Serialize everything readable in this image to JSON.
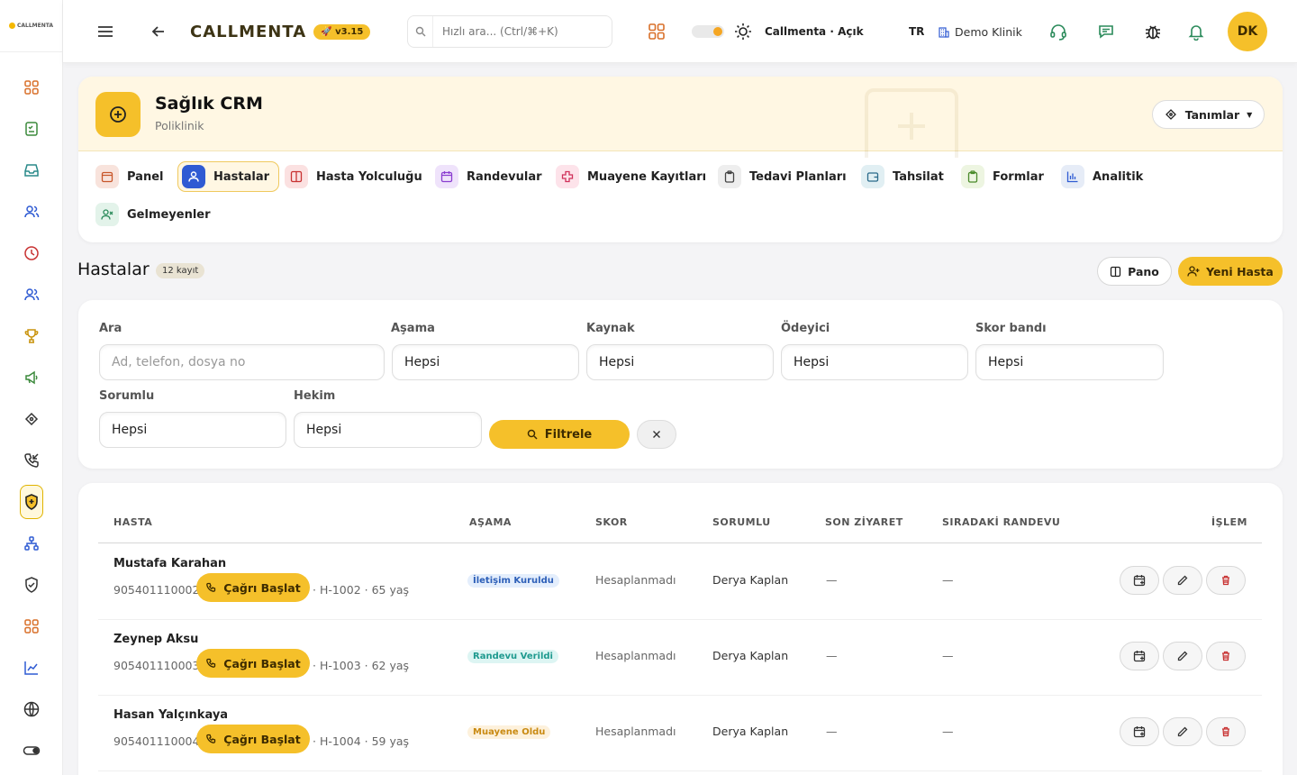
{
  "sidebar": {
    "logo_text": "CALLMENTA",
    "icons": [
      "grid-icon",
      "checklist-icon",
      "inbox-icon",
      "users-icon",
      "clock-icon",
      "team-icon",
      "trophy-icon",
      "megaphone-icon",
      "tags-icon",
      "incoming-call-icon",
      "shield-plus-icon",
      "sitemap-icon",
      "shield-check-icon",
      "apps-icon",
      "chart-line-icon",
      "globe-icon",
      "toggle-icon"
    ],
    "active_index": 10
  },
  "header": {
    "brand": "CALLMENTA",
    "version": "v3.15",
    "search_placeholder": "Hızlı ara... (Ctrl/⌘+K)",
    "company_status": "Callmenta · Açık",
    "language": "TR",
    "clinic": "Demo Klinik",
    "avatar_initials": "DK"
  },
  "module": {
    "title": "Sağlık CRM",
    "subtitle": "Poliklinik",
    "definitions_label": "Tanımlar",
    "tabs": [
      {
        "label": "Panel",
        "icon": "calendar-panel-icon",
        "color": "#f8e3dc"
      },
      {
        "label": "Hastalar",
        "icon": "user-icon",
        "color": "#2f5bd3"
      },
      {
        "label": "Hasta Yolculuğu",
        "icon": "columns-icon",
        "color": "#fbe1e1"
      },
      {
        "label": "Randevular",
        "icon": "calendar-icon",
        "color": "#efe3fb"
      },
      {
        "label": "Muayene Kayıtları",
        "icon": "medical-cross-icon",
        "color": "#fde3ea"
      },
      {
        "label": "Tedavi Planları",
        "icon": "clipboard-icon",
        "color": "#eeeeee"
      },
      {
        "label": "Tahsilat",
        "icon": "wallet-icon",
        "color": "#e1eff3"
      },
      {
        "label": "Formlar",
        "icon": "form-icon",
        "color": "#edf5e1"
      },
      {
        "label": "Analitik",
        "icon": "bar-chart-icon",
        "color": "#e6ecf7"
      },
      {
        "label": "Gelmeyenler",
        "icon": "user-x-icon",
        "color": "#e3f3ea"
      }
    ]
  },
  "section": {
    "title": "Hastalar",
    "count": "12 kayıt",
    "board_label": "Pano",
    "new_label": "Yeni Hasta"
  },
  "filters": {
    "search_label": "Ara",
    "search_placeholder": "Ad, telefon, dosya no",
    "stage_label": "Aşama",
    "stage_value": "Hepsi",
    "source_label": "Kaynak",
    "source_value": "Hepsi",
    "payer_label": "Ödeyici",
    "payer_value": "Hepsi",
    "score_label": "Skor bandı",
    "score_value": "Hepsi",
    "owner_label": "Sorumlu",
    "owner_value": "Hepsi",
    "doctor_label": "Hekim",
    "doctor_value": "Hepsi",
    "filter_label": "Filtrele"
  },
  "table": {
    "headers": [
      "HASTA",
      "AŞAMA",
      "SKOR",
      "SORUMLU",
      "SON ZİYARET",
      "SIRADAKİ RANDEVU",
      "İŞLEM"
    ],
    "call_label": "Çağrı Başlat",
    "rows": [
      {
        "name": "Mustafa Karahan",
        "phone": "905401110002",
        "meta": "· H-1002 · 65 yaş",
        "stage": "İletişim Kuruldu",
        "stage_bg": "#e4eefc",
        "stage_fg": "#2d5fb8",
        "score": "Hesaplanmadı",
        "owner": "Derya Kaplan",
        "last_visit": "—",
        "next_appt": "—"
      },
      {
        "name": "Zeynep Aksu",
        "phone": "905401110003",
        "meta": "· H-1003 · 62 yaş",
        "stage": "Randevu Verildi",
        "stage_bg": "#ddf5f3",
        "stage_fg": "#1f9a8f",
        "score": "Hesaplanmadı",
        "owner": "Derya Kaplan",
        "last_visit": "—",
        "next_appt": "—"
      },
      {
        "name": "Hasan Yalçınkaya",
        "phone": "905401110004",
        "meta": "· H-1004 · 59 yaş",
        "stage": "Muayene Oldu",
        "stage_bg": "#fdf1dc",
        "stage_fg": "#c98a12",
        "score": "Hesaplanmadı",
        "owner": "Derya Kaplan",
        "last_visit": "—",
        "next_appt": "—"
      }
    ]
  }
}
